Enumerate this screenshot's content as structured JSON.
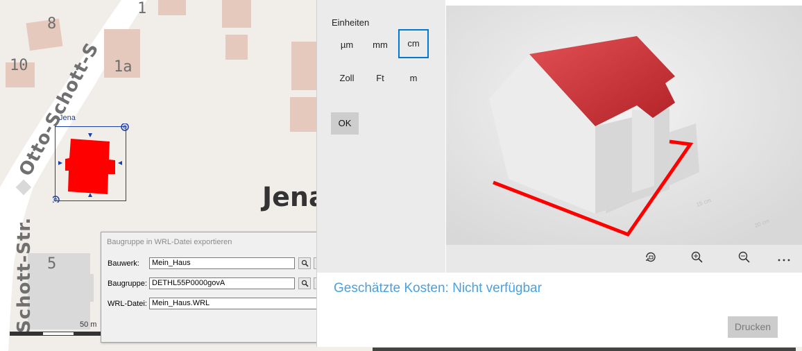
{
  "map": {
    "house_numbers": {
      "n8": "8",
      "n10": "10",
      "n1a": "1a",
      "n1": "1",
      "n5": "5"
    },
    "street_name": "Otto-Schott-S",
    "street_name_2": "Schott-Str.",
    "city": "Jena",
    "selection_label": "Jena",
    "scale": "50 m",
    "building_color": "#ff0000"
  },
  "export_dialog": {
    "title": "Baugruppe in WRL-Datei exportieren",
    "fields": [
      {
        "label": "Bauwerk:",
        "value": "Mein_Haus"
      },
      {
        "label": "Baugruppe:",
        "value": "DETHL55P0000govA"
      },
      {
        "label": "WRL-Datei:",
        "value": "Mein_Haus.WRL"
      }
    ]
  },
  "print_window": {
    "units_heading": "Einheiten",
    "units": [
      "µm",
      "mm",
      "cm",
      "Zoll",
      "Ft",
      "m"
    ],
    "selected_unit": "cm",
    "ok_label": "OK",
    "viewport": {
      "grid_label_1": "15 cm",
      "grid_label_2": "20 cm",
      "roof_color": "#c0282c",
      "frame_color": "#ff0000"
    },
    "toolbar": [
      "rotate-view-icon",
      "zoom-in-icon",
      "zoom-out-icon",
      "more-options-icon"
    ],
    "cost_text": "Geschätzte Kosten: Nicht verfügbar",
    "print_label": "Drucken",
    "accent_color": "#0078d7"
  }
}
